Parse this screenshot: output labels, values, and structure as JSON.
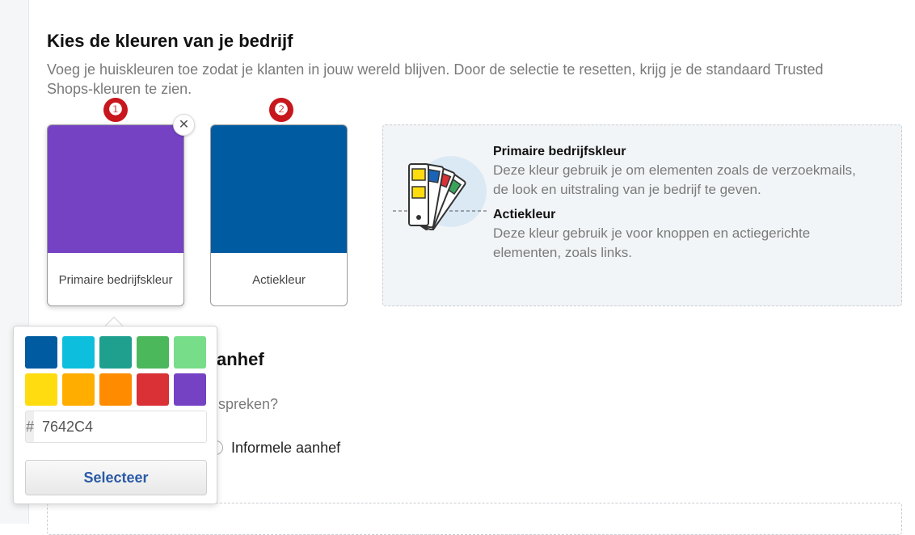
{
  "section": {
    "title": "Kies de kleuren van je bedrijf",
    "description": "Voeg je huiskleuren toe zodat je klanten in jouw wereld blijven. Door de selectie te resetten, krijg je de standaard Trusted Shops-kleuren te zien."
  },
  "badges": [
    "❶",
    "❷"
  ],
  "swatches": [
    {
      "label": "Primaire bedrijfskleur",
      "color": "#7642C4"
    },
    {
      "label": "Actiekleur",
      "color": "#005BA1"
    }
  ],
  "close_glyph": "✕",
  "info": {
    "primary_title": "Primaire bedrijfskleur",
    "primary_text": "Deze kleur gebruik je om elementen zoals de verzoekmails, de look en uitstraling van je bedrijf te geven.",
    "action_title": "Actiekleur",
    "action_text": "Deze kleur gebruik je voor knoppen en actiegerichte elementen, zoals links."
  },
  "section2": {
    "title_partial": "anhef",
    "desc_partial": "spreken?",
    "radio_label": "Informele aanhef"
  },
  "picker": {
    "palette": [
      "#005BA1",
      "#0EBFDD",
      "#1FA08F",
      "#4CB85C",
      "#77DD88",
      "#FFDC0F",
      "#FFAE00",
      "#FF8C00",
      "#D93136",
      "#7642C4"
    ],
    "hex_prefix": "#",
    "hex_value": "7642C4",
    "select_label": "Selecteer"
  }
}
